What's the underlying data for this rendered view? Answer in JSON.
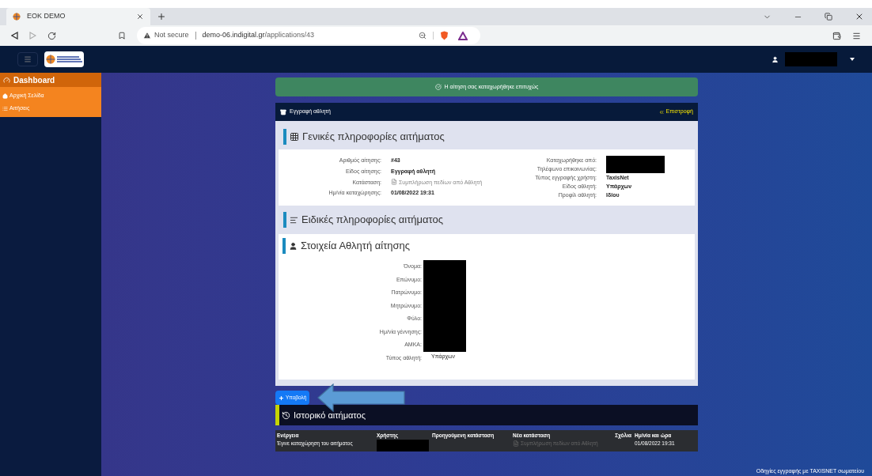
{
  "browser": {
    "tabs": [
      {
        "title": "EOK DEMO",
        "selected": true
      }
    ],
    "url": {
      "security": "Not secure",
      "host": "demo-06.indigital.gr",
      "path": "/applications/43"
    }
  },
  "sidebar": {
    "header": "Dashboard",
    "items": [
      {
        "kind": "home",
        "label": "Αρχική Σελίδα"
      },
      {
        "kind": "list",
        "label": "Αιτήσεις"
      }
    ]
  },
  "alert": "Η αίτηση σας καταχωρήθηκε επιτυχώς",
  "card": {
    "title": "Εγγραφή αθλητή",
    "back_link": "Επιστροφή"
  },
  "general": {
    "heading": "Γενικές πληροφορίες αιτήματος",
    "left": [
      {
        "label": "Αριθμός αίτησης:",
        "value": "#43",
        "kind": "text"
      },
      {
        "label": "Είδος αίτησης:",
        "value": "Εγγραφή αθλητή",
        "kind": "text"
      },
      {
        "label": "Κατάσταση:",
        "value": "Συμπλήρωση πεδίων από Αθλητή",
        "kind": "status"
      },
      {
        "label": "Ημ/νία καταχώρησης:",
        "value": "01/08/2022 19:31",
        "kind": "text"
      }
    ],
    "right": [
      {
        "label": "Καταχωρήθηκε από:",
        "redacted": true
      },
      {
        "label": "Τηλέφωνο επικοινωνίας:",
        "redacted": true
      },
      {
        "label": "Τύπος εγγραφής χρήστη:",
        "value": "TaxisNet",
        "redacted": false
      },
      {
        "label": "Είδος αθλητή:",
        "value": "Υπάρχων",
        "redacted": false
      },
      {
        "label": "Προφίλ αθλητή:",
        "value": "Ιδίου",
        "redacted": false
      }
    ]
  },
  "specific": {
    "heading": "Ειδικές πληροφορίες αιτήματος"
  },
  "athlete": {
    "heading": "Στοιχεία Αθλητή αίτησης",
    "fields": [
      {
        "label": "Όνομα:",
        "redacted": true
      },
      {
        "label": "Επώνυμο:",
        "redacted": true
      },
      {
        "label": "Πατρώνυμο:",
        "redacted": true
      },
      {
        "label": "Μητρώνυμο:",
        "redacted": true
      },
      {
        "label": "Φύλο:",
        "redacted": true
      },
      {
        "label": "Ημ/νία γέννησης:",
        "redacted": true
      },
      {
        "label": "ΑΜΚΑ:",
        "redacted": true
      },
      {
        "label": "Τύπος αθλητή:",
        "value": "Υπάρχων",
        "redacted": false
      }
    ]
  },
  "submit_button": "Υποβολή",
  "history": {
    "heading": "Ιστορικό αιτήματος",
    "columns": [
      "Ενέργεια",
      "Χρήστης",
      "Προηγούμενη κατάσταση",
      "Νέα κατάσταση",
      "Σχόλια",
      "Ημ/νία και ώρα"
    ],
    "rows": [
      [
        {
          "kind": "text",
          "value": "Έγινε καταχώρηση του αιτήματος"
        },
        {
          "kind": "redacted"
        },
        {
          "kind": "empty"
        },
        {
          "kind": "status",
          "value": "Συμπλήρωση πεδίων από Αθλητή"
        },
        {
          "kind": "empty"
        },
        {
          "kind": "text",
          "value": "01/08/2022 19:31"
        }
      ]
    ]
  },
  "footer_link": "Οδηγίες εγγραφής με TAXISNET σωματείου"
}
